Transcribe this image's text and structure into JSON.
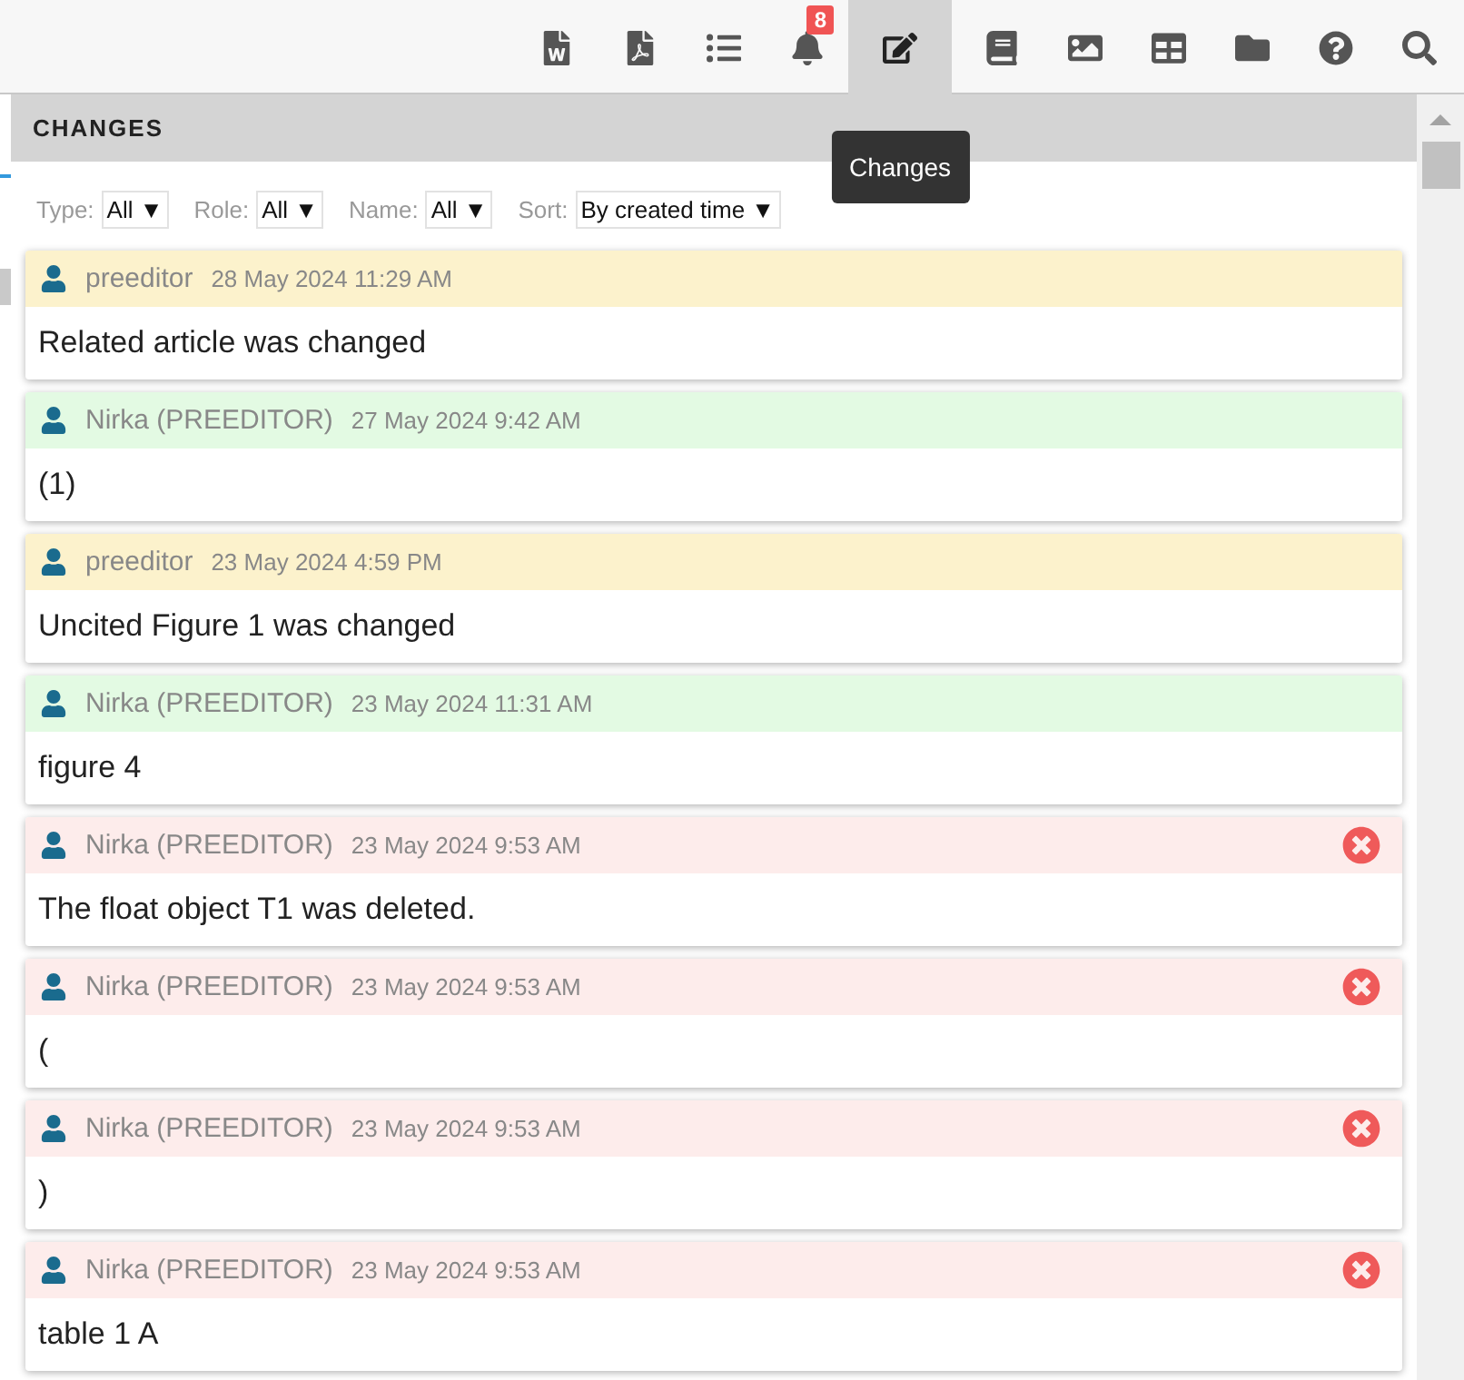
{
  "toolbar": [
    {
      "kind": "word",
      "selected": false
    },
    {
      "kind": "pdf",
      "selected": false
    },
    {
      "kind": "list",
      "selected": false
    },
    {
      "kind": "bell",
      "selected": false,
      "badge": "8"
    },
    {
      "kind": "changes",
      "selected": true,
      "tooltip": "Changes"
    },
    {
      "kind": "book",
      "selected": false
    },
    {
      "kind": "image",
      "selected": false
    },
    {
      "kind": "table",
      "selected": false
    },
    {
      "kind": "folder",
      "selected": false
    },
    {
      "kind": "help",
      "selected": false
    },
    {
      "kind": "search",
      "selected": false
    }
  ],
  "panel": {
    "title": "CHANGES",
    "filters": [
      {
        "label": "Type:",
        "value": "All ▼"
      },
      {
        "label": "Role:",
        "value": "All ▼"
      },
      {
        "label": "Name:",
        "value": "All ▼"
      },
      {
        "label": "Sort:",
        "value": "By created time ▼"
      }
    ],
    "changes": [
      {
        "kind": "changed",
        "user": "preeditor",
        "time": "28 May 2024 11:29 AM",
        "text": "Related article was changed"
      },
      {
        "kind": "inserted",
        "user": "Nirka (PREEDITOR)",
        "time": "27 May 2024 9:42 AM",
        "text": "(1)"
      },
      {
        "kind": "changed",
        "user": "preeditor",
        "time": "23 May 2024 4:59 PM",
        "text": "Uncited Figure 1 was changed"
      },
      {
        "kind": "inserted",
        "user": "Nirka (PREEDITOR)",
        "time": "23 May 2024 11:31 AM",
        "text": "figure 4"
      },
      {
        "kind": "deleted",
        "user": "Nirka (PREEDITOR)",
        "time": "23 May 2024 9:53 AM",
        "text": "The float object T1 was deleted."
      },
      {
        "kind": "deleted",
        "user": "Nirka (PREEDITOR)",
        "time": "23 May 2024 9:53 AM",
        "text": "("
      },
      {
        "kind": "deleted",
        "user": "Nirka (PREEDITOR)",
        "time": "23 May 2024 9:53 AM",
        "text": ")"
      },
      {
        "kind": "deleted",
        "user": "Nirka (PREEDITOR)",
        "time": "23 May 2024 9:53 AM",
        "text": "table 1 A"
      }
    ]
  }
}
